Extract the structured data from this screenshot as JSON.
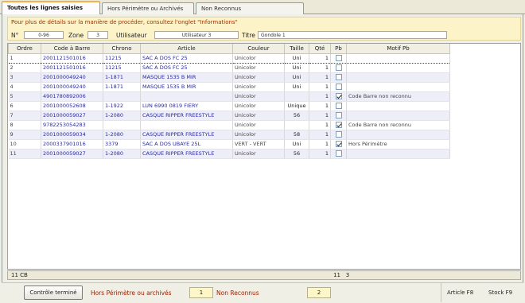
{
  "tabs": [
    {
      "label": "Toutes les lignes saisies",
      "active": true
    },
    {
      "label": "Hors Périmètre ou Archivés",
      "active": false
    },
    {
      "label": "Non Reconnus",
      "active": false
    }
  ],
  "info": {
    "message": "Pour plus de détails sur la manière de procéder, consultez l'onglet \"Informations\"",
    "no_label": "N°",
    "no_value": "0-96",
    "zone_label": "Zone",
    "zone_value": "3",
    "user_label": "Utilisateur",
    "user_value": "Utilisateur 3",
    "title_label": "Titre",
    "title_value": "Gondole 1"
  },
  "table": {
    "columns": [
      "Ordre",
      "Code à Barre",
      "Chrono",
      "Article",
      "Couleur",
      "Taille",
      "Qté",
      "Pb",
      "Motif Pb"
    ],
    "rows": [
      {
        "ordre": "1",
        "code": "2001121501016",
        "chrono": "11215",
        "article": "SAC A DOS FC 25",
        "couleur": "Unicolor",
        "taille": "Uni",
        "qte": "1",
        "pb": false,
        "motif": ""
      },
      {
        "ordre": "2",
        "code": "2001121501016",
        "chrono": "11215",
        "article": "SAC A DOS FC 25",
        "couleur": "Unicolor",
        "taille": "Uni",
        "qte": "1",
        "pb": false,
        "motif": ""
      },
      {
        "ordre": "3",
        "code": "2001000049240",
        "chrono": "1-1871",
        "article": "MASQUE 1535 B MIR",
        "couleur": "Unicolor",
        "taille": "Uni",
        "qte": "1",
        "pb": false,
        "motif": ""
      },
      {
        "ordre": "4",
        "code": "2001000049240",
        "chrono": "1-1871",
        "article": "MASQUE 1535 B MIR",
        "couleur": "Unicolor",
        "taille": "Uni",
        "qte": "1",
        "pb": false,
        "motif": ""
      },
      {
        "ordre": "5",
        "code": "4901780892006",
        "chrono": "",
        "article": "",
        "couleur": "Unicolor",
        "taille": "",
        "qte": "1",
        "pb": true,
        "motif": "Code Barre non reconnu"
      },
      {
        "ordre": "6",
        "code": "2001000052608",
        "chrono": "1-1922",
        "article": "LUN 6990 0819 FIERY",
        "couleur": "Unicolor",
        "taille": "Unique",
        "qte": "1",
        "pb": false,
        "motif": ""
      },
      {
        "ordre": "7",
        "code": "2001000059027",
        "chrono": "1-2080",
        "article": "CASQUE RIPPER FREESTYLE",
        "couleur": "Unicolor",
        "taille": "56",
        "qte": "1",
        "pb": false,
        "motif": ""
      },
      {
        "ordre": "8",
        "code": "9782253054283",
        "chrono": "",
        "article": "",
        "couleur": "Unicolor",
        "taille": "",
        "qte": "1",
        "pb": true,
        "motif": "Code Barre non reconnu"
      },
      {
        "ordre": "9",
        "code": "2001000059034",
        "chrono": "1-2080",
        "article": "CASQUE RIPPER FREESTYLE",
        "couleur": "Unicolor",
        "taille": "58",
        "qte": "1",
        "pb": false,
        "motif": ""
      },
      {
        "ordre": "10",
        "code": "2000337901016",
        "chrono": "3379",
        "article": "SAC A DOS UBAYE 25L",
        "couleur": "VERT - VERT",
        "taille": "Uni",
        "qte": "1",
        "pb": true,
        "motif": "Hors Périmètre"
      },
      {
        "ordre": "11",
        "code": "2001000059027",
        "chrono": "1-2080",
        "article": "CASQUE RIPPER FREESTYLE",
        "couleur": "Unicolor",
        "taille": "56",
        "qte": "1",
        "pb": false,
        "motif": ""
      }
    ]
  },
  "summary": {
    "count_label": "11 CB",
    "qte_total": "11",
    "pb_total": "3"
  },
  "bottom": {
    "control_button": "Contrôle terminé",
    "hors_label": "Hors Périmètre ou archivés",
    "hors_count": "1",
    "non_label": "Non Reconnus",
    "non_count": "2",
    "article_key": "Article F8",
    "stock_key": "Stock F9"
  }
}
